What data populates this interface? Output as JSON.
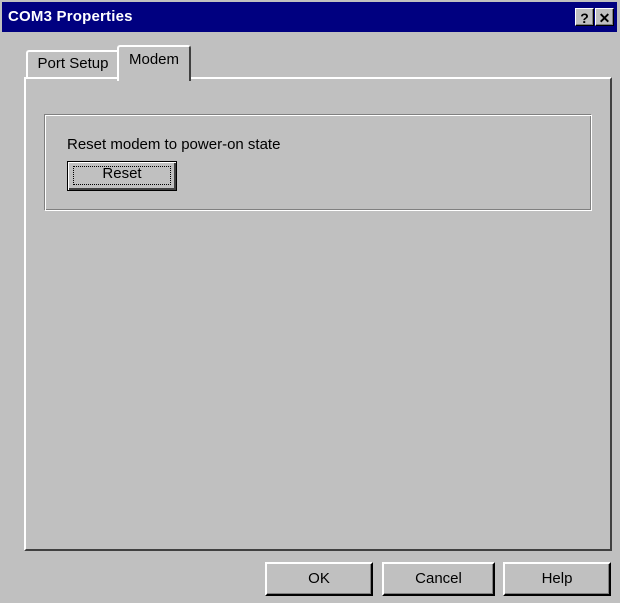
{
  "window": {
    "title": "COM3 Properties",
    "help_button_label": "?",
    "close_button_label": "✕"
  },
  "tabs": [
    {
      "label": "Port Setup",
      "selected": false
    },
    {
      "label": "Modem",
      "selected": true
    }
  ],
  "modem_tab": {
    "group_label": "Reset modem to power-on state",
    "reset_button_label": "Reset"
  },
  "footer": {
    "ok_label": "OK",
    "cancel_label": "Cancel",
    "help_label": "Help"
  },
  "colors": {
    "titlebar": "#000080",
    "face": "#c0c0c0"
  }
}
